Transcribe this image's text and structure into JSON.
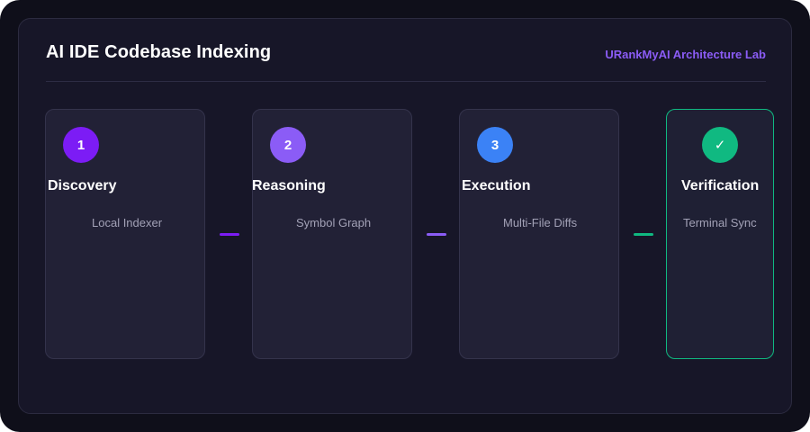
{
  "header": {
    "title": "AI IDE Codebase Indexing",
    "brand": "URankMyAI Architecture Lab"
  },
  "steps": [
    {
      "badge": "1",
      "title": "Discovery",
      "subtitle": "Local Indexer",
      "color": "#7c1cf5"
    },
    {
      "badge": "2",
      "title": "Reasoning",
      "subtitle": "Symbol Graph",
      "color": "#8b5cf6"
    },
    {
      "badge": "3",
      "title": "Execution",
      "subtitle": "Multi-File Diffs",
      "color": "#3b82f6"
    },
    {
      "badge": "✓",
      "badge_icon": "checkmark-icon",
      "title": "Verification",
      "subtitle": "Terminal Sync",
      "color": "#10b981"
    }
  ],
  "connectors": [
    {
      "color": "#7c1cf5"
    },
    {
      "color": "#8b5cf6"
    },
    {
      "color": "#10b981"
    }
  ],
  "colors": {
    "background": "#0f0f1a",
    "panel": "#171628",
    "card": "#222136",
    "brand": "#8b5cf6",
    "success": "#10b981"
  }
}
